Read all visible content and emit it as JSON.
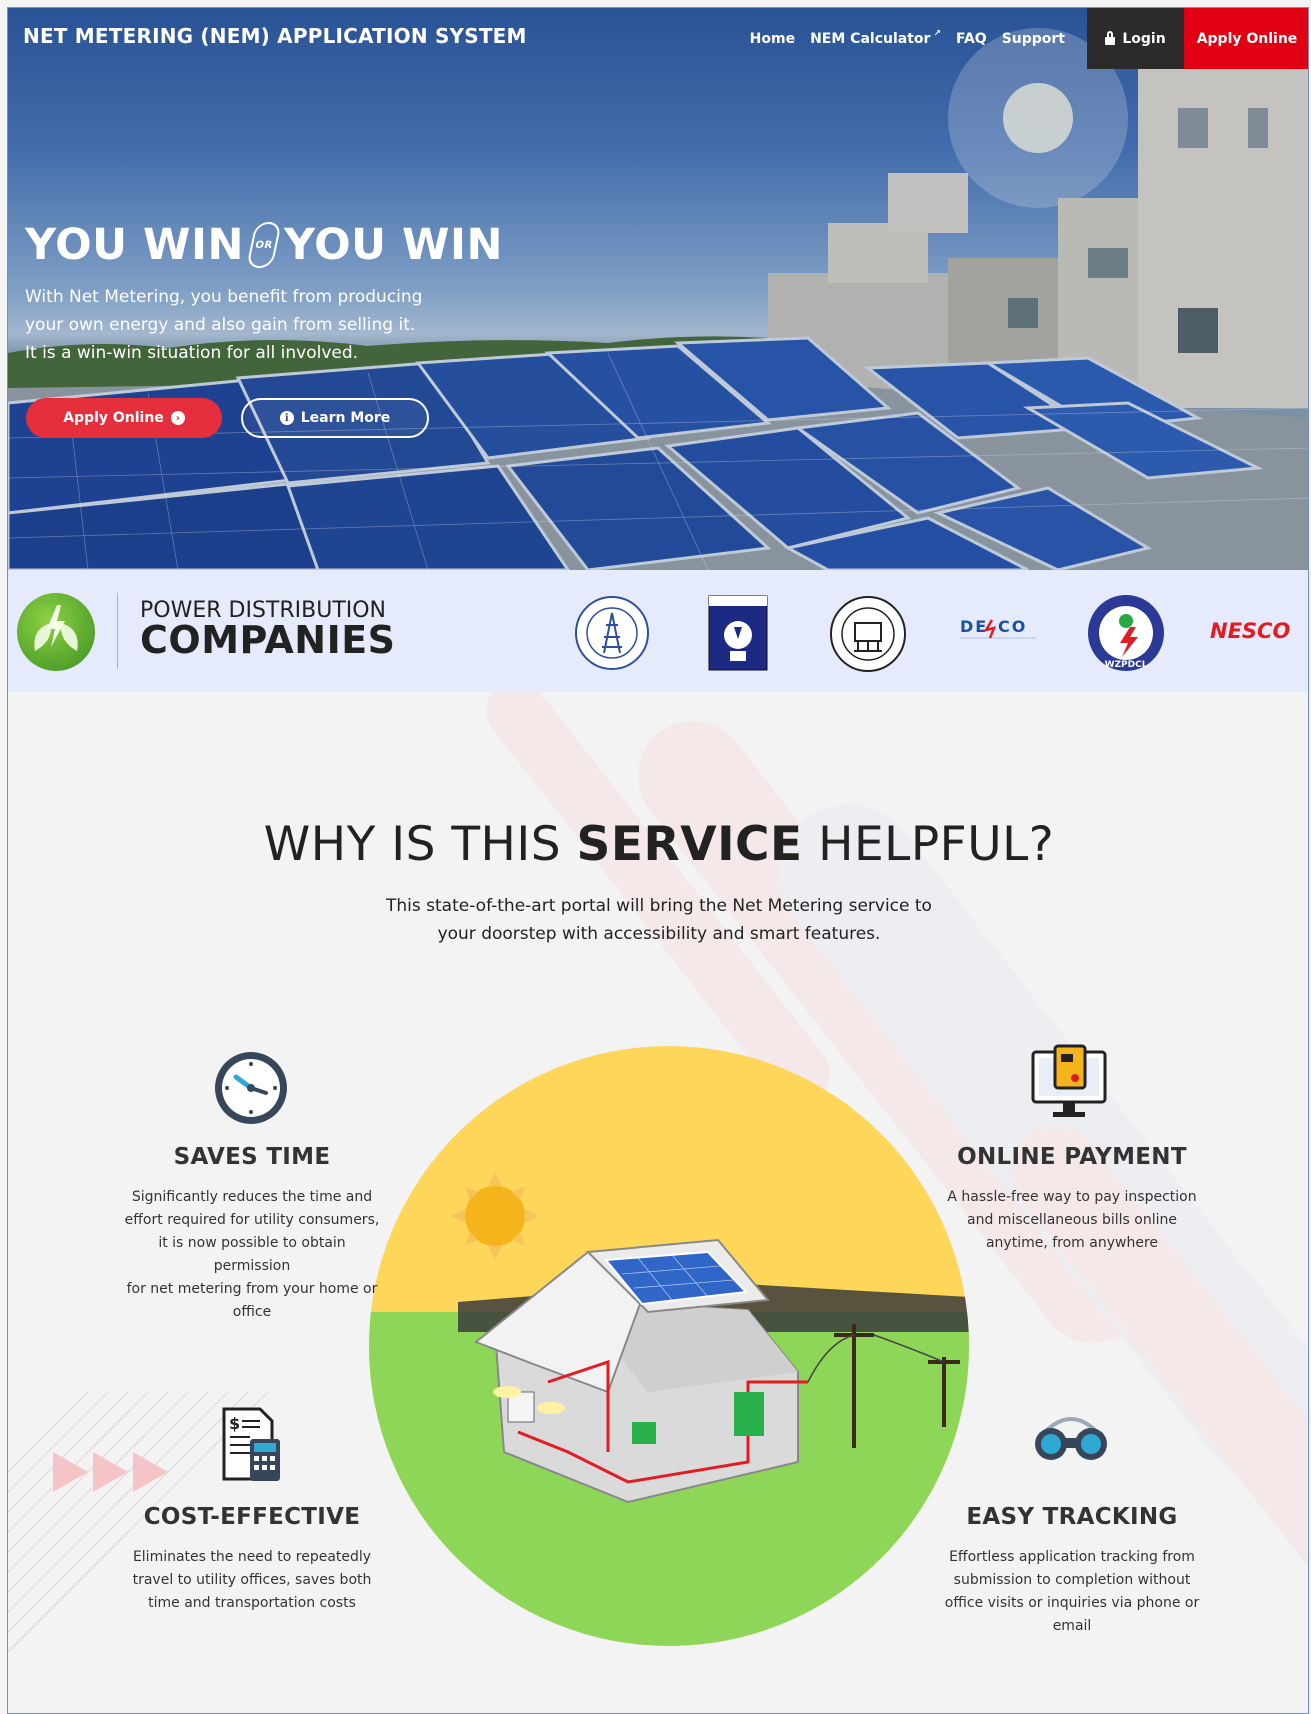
{
  "brand": "NET METERING (NEM) APPLICATION SYSTEM",
  "nav": {
    "home": "Home",
    "calculator": "NEM Calculator",
    "faq": "FAQ",
    "support": "Support",
    "login": "Login",
    "apply": "Apply Online"
  },
  "hero": {
    "headline_left": "YOU WIN",
    "headline_or": "OR",
    "headline_right": "YOU WIN",
    "subtitle_lines": [
      "With Net Metering, you benefit from producing",
      "your own energy and also gain from selling it.",
      "It is a win-win situation for all involved."
    ],
    "apply_button": "Apply Online",
    "learn_button": "Learn More"
  },
  "companies": {
    "title_top": "POWER DISTRIBUTION",
    "title_bottom": "COMPANIES",
    "logos": [
      "bpdb-icon",
      "breb-icon",
      "dpdc-icon",
      "desco-logo",
      "wzpdcl-icon",
      "nesco-logo"
    ],
    "desco_text": "DESCO",
    "nesco_text": "NESCO",
    "wzpdcl_text": "WZPDCL"
  },
  "why": {
    "title_pre": "WHY IS THIS ",
    "title_bold": "SERVICE",
    "title_post": " HELPFUL?",
    "subtitle_lines": [
      "This state-of-the-art portal will bring the Net Metering service to",
      "your doorstep with accessibility and smart features."
    ],
    "features": [
      {
        "title": "SAVES TIME",
        "icon": "clock-icon",
        "desc": [
          "Significantly reduces the time and",
          "effort required for utility consumers,",
          "it is now possible to obtain permission",
          "for net metering from your home or",
          "office"
        ]
      },
      {
        "title": "ONLINE PAYMENT",
        "icon": "payment-monitor-icon",
        "desc": [
          "A hassle-free way to pay inspection",
          "and miscellaneous bills online",
          "anytime, from anywhere"
        ]
      },
      {
        "title": "COST-EFFECTIVE",
        "icon": "invoice-calculator-icon",
        "desc": [
          "Eliminates the need to repeatedly",
          "travel to utility offices, saves both",
          "time and transportation costs"
        ]
      },
      {
        "title": "EASY TRACKING",
        "icon": "binoculars-icon",
        "desc": [
          "Effortless application tracking from",
          "submission to completion without",
          "office visits or inquiries via phone or",
          "email"
        ]
      }
    ]
  },
  "colors": {
    "accent_red": "#e10013",
    "button_red": "#e52f3c",
    "dark": "#2b2b2b",
    "band": "#e5ebfb"
  }
}
